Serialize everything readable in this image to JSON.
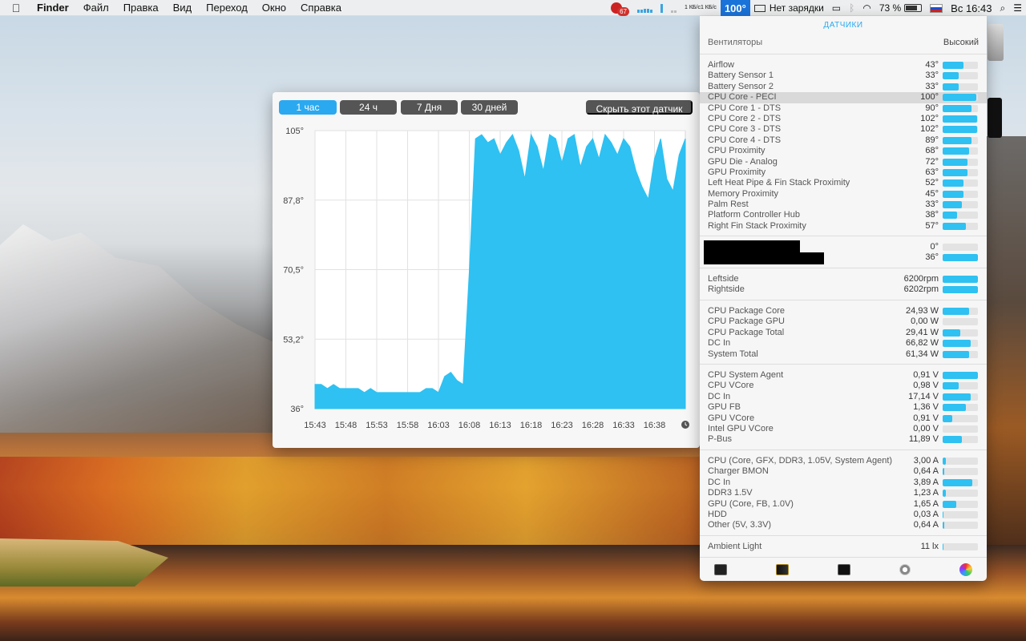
{
  "menubar": {
    "app_name": "Finder",
    "items": [
      "Файл",
      "Правка",
      "Вид",
      "Переход",
      "Окно",
      "Справка"
    ],
    "status": {
      "badge_count": "67",
      "net_up": "1 КБ/с",
      "net_down": "1 КБ/с",
      "cpu_temp": "100°",
      "charge_status": "Нет зарядки",
      "battery_percent": "73 %",
      "datetime": "Вс 16:43"
    }
  },
  "graph_window": {
    "range_buttons": [
      "1 час",
      "24 ч",
      "7 Дня",
      "30 дней"
    ],
    "active_range": "1 час",
    "hide_button": "Скрыть этот датчик"
  },
  "chart_data": {
    "type": "area",
    "series_color": "#2ec1f2",
    "ylim": [
      36,
      105
    ],
    "yticks": [
      "105°",
      "87,8°",
      "70,5°",
      "53,2°",
      "36°"
    ],
    "xticks": [
      "15:43",
      "15:48",
      "15:53",
      "15:58",
      "16:03",
      "16:08",
      "16:13",
      "16:18",
      "16:23",
      "16:28",
      "16:33",
      "16:38"
    ],
    "grid": true,
    "x": [
      "15:43",
      "15:44",
      "15:45",
      "15:46",
      "15:47",
      "15:48",
      "15:49",
      "15:50",
      "15:51",
      "15:52",
      "15:53",
      "15:54",
      "15:55",
      "15:56",
      "15:57",
      "15:58",
      "15:59",
      "16:00",
      "16:01",
      "16:02",
      "16:03",
      "16:04",
      "16:05",
      "16:06",
      "16:07",
      "16:08",
      "16:09",
      "16:10",
      "16:11",
      "16:12",
      "16:13",
      "16:14",
      "16:15",
      "16:16",
      "16:17",
      "16:18",
      "16:19",
      "16:20",
      "16:21",
      "16:22",
      "16:23",
      "16:24",
      "16:25",
      "16:26",
      "16:27",
      "16:28",
      "16:29",
      "16:30",
      "16:31",
      "16:32",
      "16:33",
      "16:34",
      "16:35",
      "16:36",
      "16:37",
      "16:38",
      "16:39",
      "16:40",
      "16:41",
      "16:42",
      "16:43"
    ],
    "values": [
      42,
      42,
      41,
      42,
      41,
      41,
      41,
      41,
      40,
      41,
      40,
      40,
      40,
      40,
      40,
      40,
      40,
      40,
      41,
      41,
      40,
      44,
      45,
      43,
      42,
      70,
      103,
      104,
      102,
      103,
      99,
      102,
      104,
      100,
      93,
      104,
      101,
      95,
      104,
      103,
      97,
      103,
      104,
      96,
      101,
      103,
      98,
      104,
      102,
      99,
      103,
      101,
      95,
      91,
      88,
      98,
      103,
      93,
      90,
      99,
      103
    ]
  },
  "sensors": {
    "title": "ДАТЧИКИ",
    "fans_label": "Вентиляторы",
    "fans_mode": "Высокий",
    "temperatures": [
      {
        "name": "Airflow",
        "value": "43°",
        "level": 0.6
      },
      {
        "name": "Battery Sensor 1",
        "value": "33°",
        "level": 0.45
      },
      {
        "name": "Battery Sensor 2",
        "value": "33°",
        "level": 0.45
      },
      {
        "name": "CPU Core - PECI",
        "value": "100°",
        "level": 0.95
      },
      {
        "name": "CPU Core 1 - DTS",
        "value": "90°",
        "level": 0.82
      },
      {
        "name": "CPU Core 2 - DTS",
        "value": "102°",
        "level": 0.97
      },
      {
        "name": "CPU Core 3 - DTS",
        "value": "102°",
        "level": 0.97
      },
      {
        "name": "CPU Core 4 - DTS",
        "value": "89°",
        "level": 0.82
      },
      {
        "name": "CPU Proximity",
        "value": "68°",
        "level": 0.75
      },
      {
        "name": "GPU Die - Analog",
        "value": "72°",
        "level": 0.7
      },
      {
        "name": "GPU Proximity",
        "value": "63°",
        "level": 0.7
      },
      {
        "name": "Left Heat Pipe & Fin Stack Proximity",
        "value": "52°",
        "level": 0.6
      },
      {
        "name": "Memory Proximity",
        "value": "45°",
        "level": 0.6
      },
      {
        "name": "Palm Rest",
        "value": "33°",
        "level": 0.55
      },
      {
        "name": "Platform Controller Hub",
        "value": "38°",
        "level": 0.4
      },
      {
        "name": "Right Fin Stack Proximity",
        "value": "57°",
        "level": 0.65
      }
    ],
    "redacted": [
      {
        "value": "0°",
        "level": 0.0
      },
      {
        "value": "36°",
        "level": 1.0
      }
    ],
    "fans": [
      {
        "name": "Leftside",
        "value": "6200rpm",
        "level": 1.0
      },
      {
        "name": "Rightside",
        "value": "6202rpm",
        "level": 1.0
      }
    ],
    "power": [
      {
        "name": "CPU Package Core",
        "value": "24,93 W",
        "level": 0.75
      },
      {
        "name": "CPU Package GPU",
        "value": "0,00 W",
        "level": 0.0
      },
      {
        "name": "CPU Package Total",
        "value": "29,41 W",
        "level": 0.5
      },
      {
        "name": "DC In",
        "value": "66,82 W",
        "level": 0.8
      },
      {
        "name": "System Total",
        "value": "61,34 W",
        "level": 0.75
      }
    ],
    "voltage": [
      {
        "name": "CPU System Agent",
        "value": "0,91 V",
        "level": 1.0
      },
      {
        "name": "CPU VCore",
        "value": "0,98 V",
        "level": 0.45
      },
      {
        "name": "DC In",
        "value": "17,14 V",
        "level": 0.8
      },
      {
        "name": "GPU FB",
        "value": "1,36 V",
        "level": 0.65
      },
      {
        "name": "GPU VCore",
        "value": "0,91 V",
        "level": 0.28
      },
      {
        "name": "Intel GPU VCore",
        "value": "0,00 V",
        "level": 0.0
      },
      {
        "name": "P-Bus",
        "value": "11,89 V",
        "level": 0.55
      }
    ],
    "current": [
      {
        "name": "CPU (Core, GFX, DDR3, 1.05V, System Agent)",
        "value": "3,00 A",
        "level": 0.08
      },
      {
        "name": "Charger BMON",
        "value": "0,64 A",
        "level": 0.05
      },
      {
        "name": "DC In",
        "value": "3,89 A",
        "level": 0.85
      },
      {
        "name": "DDR3 1.5V",
        "value": "1,23 A",
        "level": 0.1
      },
      {
        "name": "GPU (Core, FB, 1.0V)",
        "value": "1,65 A",
        "level": 0.38
      },
      {
        "name": "HDD",
        "value": "0,03 A",
        "level": 0.02
      },
      {
        "name": "Other (5V, 3.3V)",
        "value": "0,64 A",
        "level": 0.05
      }
    ],
    "light": [
      {
        "name": "Ambient Light",
        "value": "11 lx",
        "level": 0.02
      }
    ]
  }
}
